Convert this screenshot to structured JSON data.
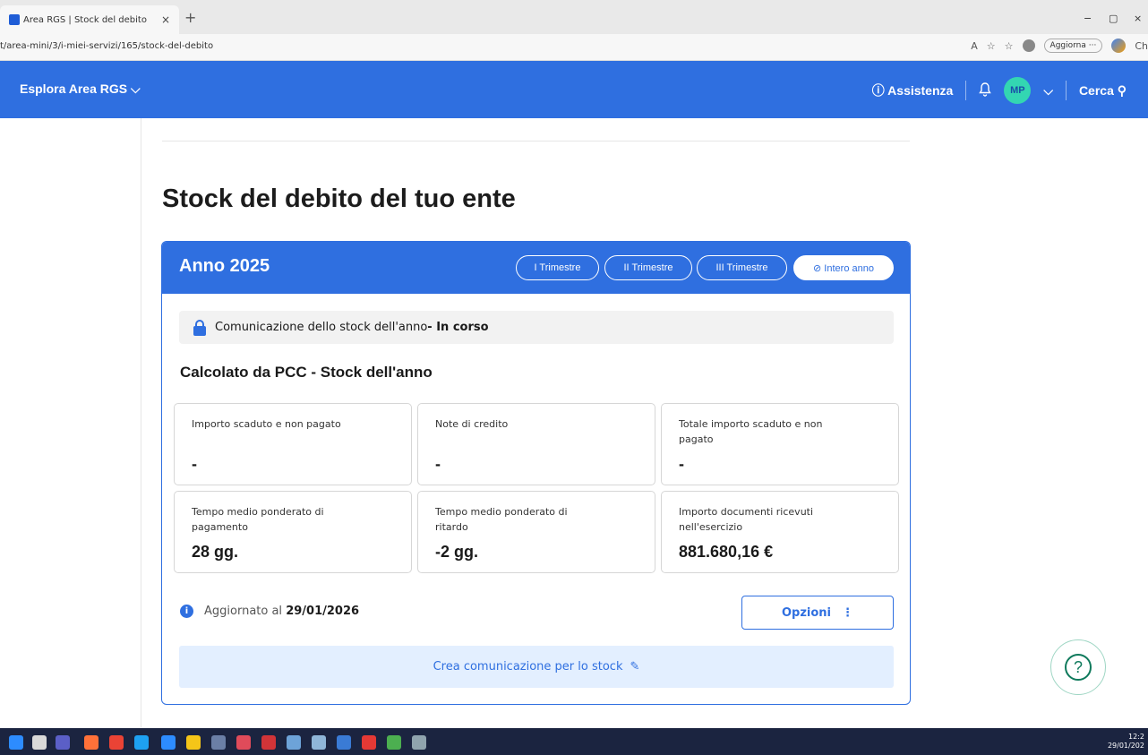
{
  "browser": {
    "tab_title": "Area RGS | Stock del debito",
    "tab_close": "×",
    "new_tab": "+",
    "url": "t/area-mini/3/i-miei-servizi/165/stock-del-debito",
    "update_label": "Aggiorna ···",
    "ch_label": "Ch",
    "win_min": "−",
    "win_max": "▢",
    "win_close": "×"
  },
  "header": {
    "explore": "Esplora Area RGS ⌵",
    "assistance": "ⓘ Assistenza",
    "avatar": "MP",
    "avatar_chevron": "⌵",
    "search": "Cerca ⚲"
  },
  "page": {
    "title": "Stock del debito del tuo ente"
  },
  "card": {
    "year": "Anno 2025",
    "periods": [
      "I Trimestre",
      "II Trimestre",
      "III Trimestre",
      "⊘ Intero anno"
    ],
    "status_text": "Comunicazione dello stock dell'anno",
    "status_state": " - In corso",
    "subtitle": "Calcolato da PCC - Stock dell'anno",
    "metrics": [
      {
        "label": "Importo scaduto e non pagato",
        "value": "-"
      },
      {
        "label": "Note di credito",
        "value": "-"
      },
      {
        "label": "Totale importo scaduto e non pagato",
        "value": "-"
      },
      {
        "label": "Tempo medio ponderato di pagamento",
        "value": "28 gg."
      },
      {
        "label": "Tempo medio ponderato di ritardo",
        "value": "-2 gg."
      },
      {
        "label": "Importo documenti ricevuti nell'esercizio",
        "value": "881.680,16 €"
      }
    ],
    "updated_prefix": "Aggiornato al",
    "updated_date": "29/01/2026",
    "options_label": "Opzioni",
    "options_icon": "⋮",
    "create_label": "Crea comunicazione per lo stock",
    "create_icon": "✎"
  },
  "help_icon": "?",
  "taskbar": {
    "time": "12:2",
    "date": "29/01/202"
  }
}
